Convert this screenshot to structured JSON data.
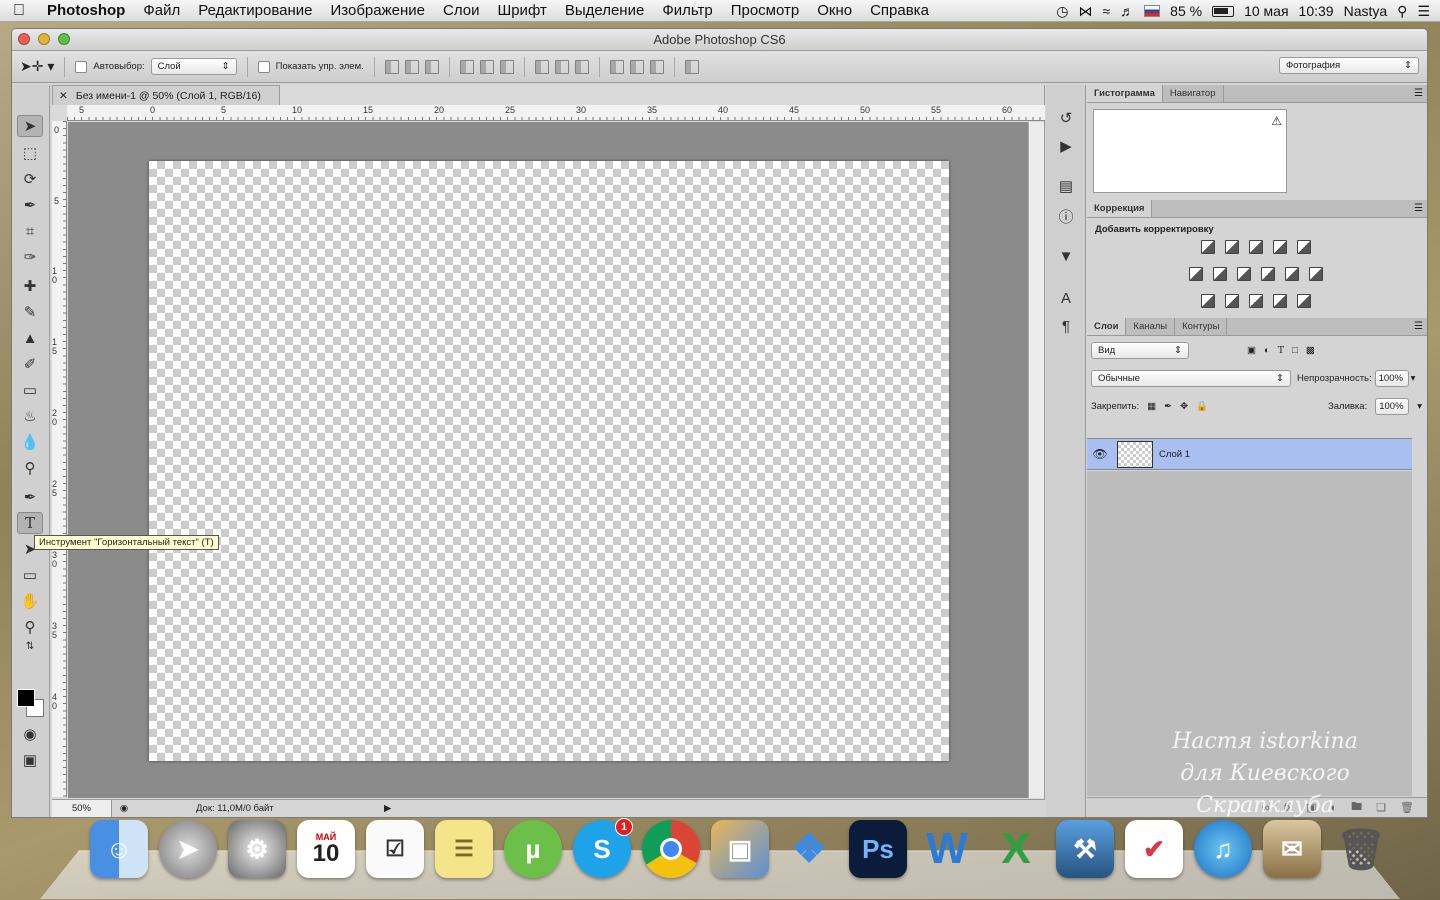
{
  "menubar": {
    "app_name": "Photoshop",
    "items": [
      "Файл",
      "Редактирование",
      "Изображение",
      "Слои",
      "Шрифт",
      "Выделение",
      "Фильтр",
      "Просмотр",
      "Окно",
      "Справка"
    ],
    "battery": "85 %",
    "date": "10 мая",
    "time": "10:39",
    "user": "Nastya"
  },
  "window": {
    "title": "Adobe Photoshop CS6"
  },
  "options_bar": {
    "autoselect_label": "Автовыбор:",
    "autoselect_value": "Слой",
    "show_controls_label": "Показать упр. элем.",
    "workspace_value": "Фотография"
  },
  "document": {
    "tab_title": "Без имени-1 @ 50% (Слой 1, RGB/16)",
    "ruler_h": [
      "5",
      "0",
      "5",
      "10",
      "15",
      "20",
      "25",
      "30",
      "35",
      "40",
      "45",
      "50",
      "55",
      "60"
    ],
    "ruler_v": [
      "0",
      "5",
      "10",
      "15",
      "20",
      "25",
      "30",
      "35",
      "40"
    ],
    "zoom": "50%",
    "doc_info": "Док: 11,0M/0 байт"
  },
  "tooltip": "Инструмент \"Горизонтальный текст\" (T)",
  "panels": {
    "histogram_tabs": [
      "Гистограмма",
      "Навигатор"
    ],
    "corrections_tab": "Коррекция",
    "corrections_title": "Добавить корректировку",
    "layers_tabs": [
      "Слои",
      "Каналы",
      "Контуры"
    ],
    "filter_kind": "Вид",
    "blend_mode": "Обычные",
    "opacity_label": "Непрозрачность:",
    "opacity_value": "100%",
    "lock_label": "Закрепить:",
    "fill_label": "Заливка:",
    "fill_value": "100%",
    "layer_name": "Слой 1"
  },
  "watermark": [
    "Настя istorkina",
    "для Киевского Скрапклуба"
  ],
  "colors": {
    "accent_selection": "#a8bff0",
    "canvas_bg": "#8b8b8b"
  },
  "dock": {
    "badge_count": "1",
    "calendar_day": "10",
    "calendar_month": "МАЙ"
  }
}
